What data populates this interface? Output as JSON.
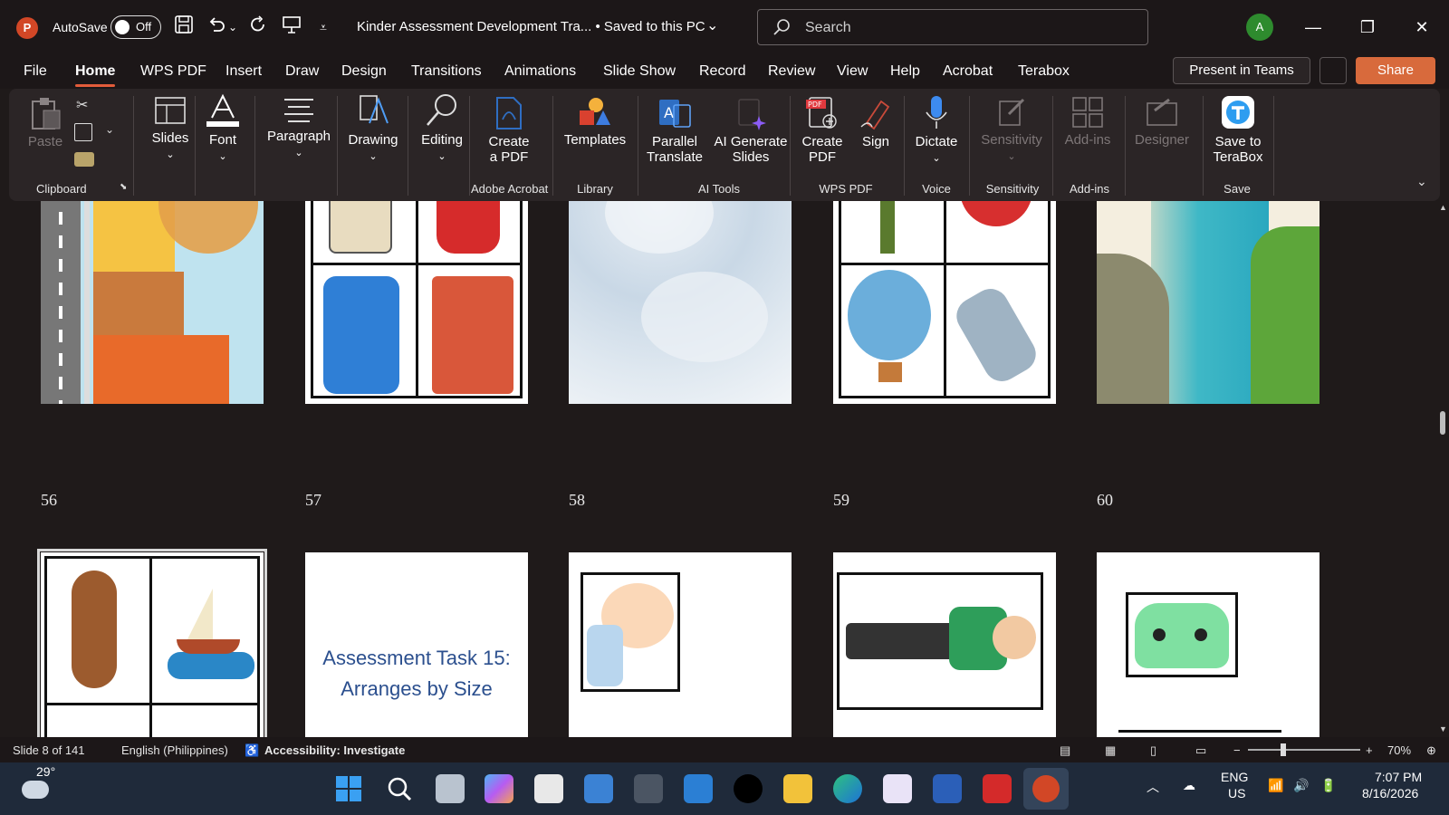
{
  "titlebar": {
    "app_logo": "P",
    "autosave_label": "AutoSave",
    "autosave_state": "Off",
    "doc_title": "Kinder Assessment Development Tra...  •  Saved to this PC",
    "search_placeholder": "Search",
    "avatar_initial": "A"
  },
  "menu": {
    "tabs": [
      "File",
      "Home",
      "WPS PDF",
      "Insert",
      "Draw",
      "Design",
      "Transitions",
      "Animations",
      "Slide Show",
      "Record",
      "Review",
      "View",
      "Help",
      "Acrobat",
      "Terabox"
    ],
    "active_tab": "Home",
    "present_label": "Present in Teams",
    "share_label": "Share"
  },
  "ribbon": {
    "paste": "Paste",
    "slides": "Slides",
    "font": "Font",
    "paragraph": "Paragraph",
    "drawing": "Drawing",
    "editing": "Editing",
    "create_pdf_1": "Create",
    "create_pdf_2": "a PDF",
    "templates": "Templates",
    "parallel_1": "Parallel",
    "parallel_2": "Translate",
    "ai_gen_1": "AI Generate",
    "ai_gen_2": "Slides",
    "wps_create_1": "Create",
    "wps_create_2": "PDF",
    "sign": "Sign",
    "dictate": "Dictate",
    "sensitivity": "Sensitivity",
    "addins": "Add-ins",
    "designer": "Designer",
    "terabox_1": "Save to",
    "terabox_2": "TeraBox",
    "groups": {
      "clipboard": "Clipboard",
      "adobe": "Adobe Acrobat",
      "library": "Library",
      "ai_tools": "AI Tools",
      "wps_pdf": "WPS PDF",
      "voice": "Voice",
      "sensitivity": "Sensitivity",
      "addins": "Add-ins",
      "save": "Save"
    }
  },
  "slides": {
    "row1": [
      "56",
      "57",
      "58",
      "59",
      "60"
    ],
    "task_title_1": "Assessment Task 15:",
    "task_title_2": "Arranges by Size"
  },
  "status": {
    "slide_count": "Slide 8 of 141",
    "language": "English (Philippines)",
    "accessibility": "Accessibility: Investigate",
    "zoom": "70%"
  },
  "taskbar": {
    "temperature": "29°",
    "lang_1": "ENG",
    "lang_2": "US",
    "time": "7:07 PM",
    "date": "8/16/2026"
  },
  "colors": {
    "accent": "#e25c3a",
    "share": "#d86a3c",
    "ribbon_bg": "#2b2526",
    "title_bg": "#1c1718",
    "taskbar_bg": "#1f2a3a"
  }
}
